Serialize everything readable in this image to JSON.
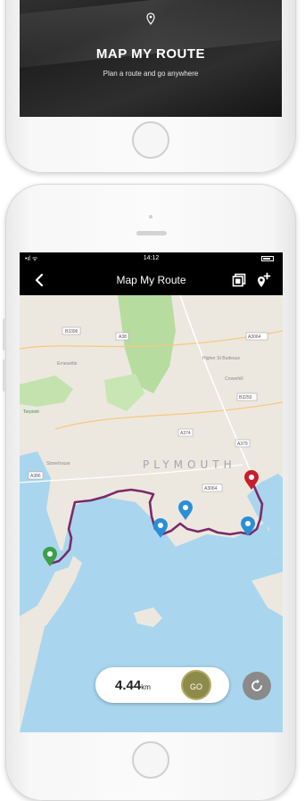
{
  "splash": {
    "title": "MAP MY ROUTE",
    "subtitle": "Plan a route and go anywhere"
  },
  "status": {
    "time": "14:12"
  },
  "header": {
    "title": "Map My Route"
  },
  "map": {
    "city_label": "PLYMOUTH",
    "road_labels": [
      "B3396",
      "A38",
      "A3064",
      "B3250",
      "A374",
      "A379",
      "A386",
      "A3064"
    ],
    "area_labels": [
      "Ernesettle",
      "Higher St Budeaux",
      "Crownhill",
      "Torpoint",
      "Stonehouse"
    ]
  },
  "route": {
    "distance": "4.44",
    "unit": "km",
    "go_label": "GO"
  },
  "colors": {
    "route": "#7a2a6a",
    "start_pin": "#3aa04a",
    "end_pin": "#c81e2c",
    "waypoint_pin": "#2a8fd6",
    "water": "#a9d6ee",
    "land": "#ece8df",
    "park": "#b7dca0",
    "go_button": "#8e8a4a"
  },
  "icons": {
    "back": "chevron-left-icon",
    "layers": "layers-icon",
    "add_pin": "add-pin-icon",
    "recenter": "recenter-icon",
    "splash": "location-pin-icon"
  }
}
